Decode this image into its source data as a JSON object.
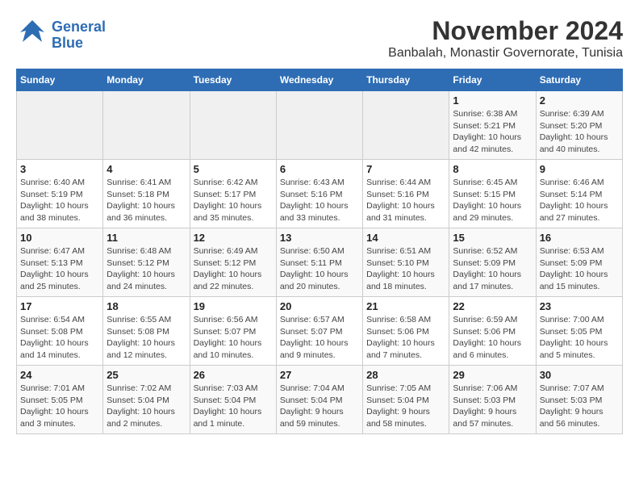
{
  "header": {
    "logo_line1": "General",
    "logo_line2": "Blue",
    "title": "November 2024",
    "subtitle": "Banbalah, Monastir Governorate, Tunisia"
  },
  "weekdays": [
    "Sunday",
    "Monday",
    "Tuesday",
    "Wednesday",
    "Thursday",
    "Friday",
    "Saturday"
  ],
  "weeks": [
    [
      {
        "day": "",
        "detail": ""
      },
      {
        "day": "",
        "detail": ""
      },
      {
        "day": "",
        "detail": ""
      },
      {
        "day": "",
        "detail": ""
      },
      {
        "day": "",
        "detail": ""
      },
      {
        "day": "1",
        "detail": "Sunrise: 6:38 AM\nSunset: 5:21 PM\nDaylight: 10 hours and 42 minutes."
      },
      {
        "day": "2",
        "detail": "Sunrise: 6:39 AM\nSunset: 5:20 PM\nDaylight: 10 hours and 40 minutes."
      }
    ],
    [
      {
        "day": "3",
        "detail": "Sunrise: 6:40 AM\nSunset: 5:19 PM\nDaylight: 10 hours and 38 minutes."
      },
      {
        "day": "4",
        "detail": "Sunrise: 6:41 AM\nSunset: 5:18 PM\nDaylight: 10 hours and 36 minutes."
      },
      {
        "day": "5",
        "detail": "Sunrise: 6:42 AM\nSunset: 5:17 PM\nDaylight: 10 hours and 35 minutes."
      },
      {
        "day": "6",
        "detail": "Sunrise: 6:43 AM\nSunset: 5:16 PM\nDaylight: 10 hours and 33 minutes."
      },
      {
        "day": "7",
        "detail": "Sunrise: 6:44 AM\nSunset: 5:16 PM\nDaylight: 10 hours and 31 minutes."
      },
      {
        "day": "8",
        "detail": "Sunrise: 6:45 AM\nSunset: 5:15 PM\nDaylight: 10 hours and 29 minutes."
      },
      {
        "day": "9",
        "detail": "Sunrise: 6:46 AM\nSunset: 5:14 PM\nDaylight: 10 hours and 27 minutes."
      }
    ],
    [
      {
        "day": "10",
        "detail": "Sunrise: 6:47 AM\nSunset: 5:13 PM\nDaylight: 10 hours and 25 minutes."
      },
      {
        "day": "11",
        "detail": "Sunrise: 6:48 AM\nSunset: 5:12 PM\nDaylight: 10 hours and 24 minutes."
      },
      {
        "day": "12",
        "detail": "Sunrise: 6:49 AM\nSunset: 5:12 PM\nDaylight: 10 hours and 22 minutes."
      },
      {
        "day": "13",
        "detail": "Sunrise: 6:50 AM\nSunset: 5:11 PM\nDaylight: 10 hours and 20 minutes."
      },
      {
        "day": "14",
        "detail": "Sunrise: 6:51 AM\nSunset: 5:10 PM\nDaylight: 10 hours and 18 minutes."
      },
      {
        "day": "15",
        "detail": "Sunrise: 6:52 AM\nSunset: 5:09 PM\nDaylight: 10 hours and 17 minutes."
      },
      {
        "day": "16",
        "detail": "Sunrise: 6:53 AM\nSunset: 5:09 PM\nDaylight: 10 hours and 15 minutes."
      }
    ],
    [
      {
        "day": "17",
        "detail": "Sunrise: 6:54 AM\nSunset: 5:08 PM\nDaylight: 10 hours and 14 minutes."
      },
      {
        "day": "18",
        "detail": "Sunrise: 6:55 AM\nSunset: 5:08 PM\nDaylight: 10 hours and 12 minutes."
      },
      {
        "day": "19",
        "detail": "Sunrise: 6:56 AM\nSunset: 5:07 PM\nDaylight: 10 hours and 10 minutes."
      },
      {
        "day": "20",
        "detail": "Sunrise: 6:57 AM\nSunset: 5:07 PM\nDaylight: 10 hours and 9 minutes."
      },
      {
        "day": "21",
        "detail": "Sunrise: 6:58 AM\nSunset: 5:06 PM\nDaylight: 10 hours and 7 minutes."
      },
      {
        "day": "22",
        "detail": "Sunrise: 6:59 AM\nSunset: 5:06 PM\nDaylight: 10 hours and 6 minutes."
      },
      {
        "day": "23",
        "detail": "Sunrise: 7:00 AM\nSunset: 5:05 PM\nDaylight: 10 hours and 5 minutes."
      }
    ],
    [
      {
        "day": "24",
        "detail": "Sunrise: 7:01 AM\nSunset: 5:05 PM\nDaylight: 10 hours and 3 minutes."
      },
      {
        "day": "25",
        "detail": "Sunrise: 7:02 AM\nSunset: 5:04 PM\nDaylight: 10 hours and 2 minutes."
      },
      {
        "day": "26",
        "detail": "Sunrise: 7:03 AM\nSunset: 5:04 PM\nDaylight: 10 hours and 1 minute."
      },
      {
        "day": "27",
        "detail": "Sunrise: 7:04 AM\nSunset: 5:04 PM\nDaylight: 9 hours and 59 minutes."
      },
      {
        "day": "28",
        "detail": "Sunrise: 7:05 AM\nSunset: 5:04 PM\nDaylight: 9 hours and 58 minutes."
      },
      {
        "day": "29",
        "detail": "Sunrise: 7:06 AM\nSunset: 5:03 PM\nDaylight: 9 hours and 57 minutes."
      },
      {
        "day": "30",
        "detail": "Sunrise: 7:07 AM\nSunset: 5:03 PM\nDaylight: 9 hours and 56 minutes."
      }
    ]
  ]
}
